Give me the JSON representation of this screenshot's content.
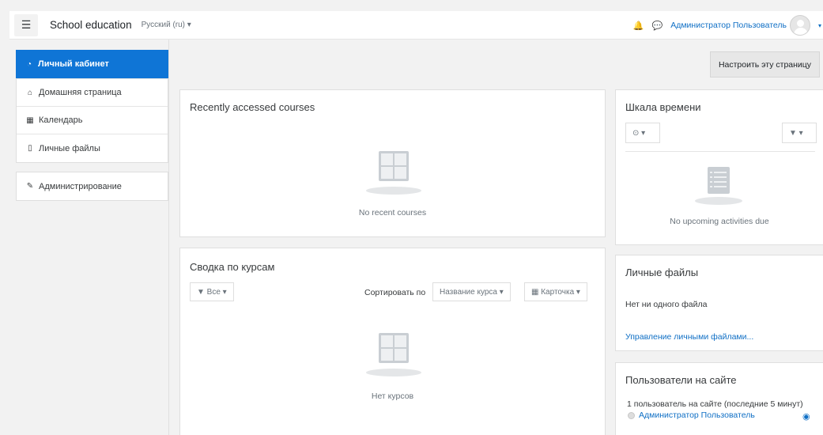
{
  "navbar": {
    "menu_icon": "☰",
    "site_name": "School education",
    "language": "Русский (ru) ▾",
    "bell_icon": "🔔",
    "chat_icon": "💬",
    "user_name": "Администратор Пользователь",
    "user_chevron": "▾"
  },
  "drawer": {
    "items": [
      {
        "icon": "dashboard-icon",
        "glyph": "◔",
        "label": "Личный кабинет"
      },
      {
        "icon": "home-icon",
        "glyph": "⌂",
        "label": "Домашняя страница"
      },
      {
        "icon": "calendar-icon",
        "glyph": "▦",
        "label": "Календарь"
      },
      {
        "icon": "file-icon",
        "glyph": "▯",
        "label": "Личные файлы"
      }
    ],
    "admin": {
      "icon": "wrench-icon",
      "glyph": "✎",
      "label": "Администрирование"
    }
  },
  "header": {
    "customize_label": "Настроить эту страницу"
  },
  "recent": {
    "title": "Recently accessed courses",
    "empty_text": "No recent courses"
  },
  "overview": {
    "title": "Сводка по курсам",
    "filter_label": "▼ Все ▾",
    "sort_prefix": "Сортировать по",
    "sort_value": "Название курса ▾",
    "view_value": "▦ Карточка ▾",
    "empty_text": "Нет курсов"
  },
  "timeline": {
    "title": "Шкала времени",
    "clock_btn": "⊙ ▾",
    "filter_btn": "▼ ▾",
    "empty_text": "No upcoming activities due"
  },
  "files": {
    "title": "Личные файлы",
    "empty_text": "Нет ни одного файла",
    "manage_link": "Управление личными файлами..."
  },
  "online": {
    "title": "Пользователи на сайте",
    "summary": "1 пользователь на сайте (последние 5 минут)",
    "user": "Администратор Пользователь",
    "eye_icon": "◉"
  },
  "colors": {
    "accent": "#0f75d6",
    "link": "#0f6fc5"
  }
}
